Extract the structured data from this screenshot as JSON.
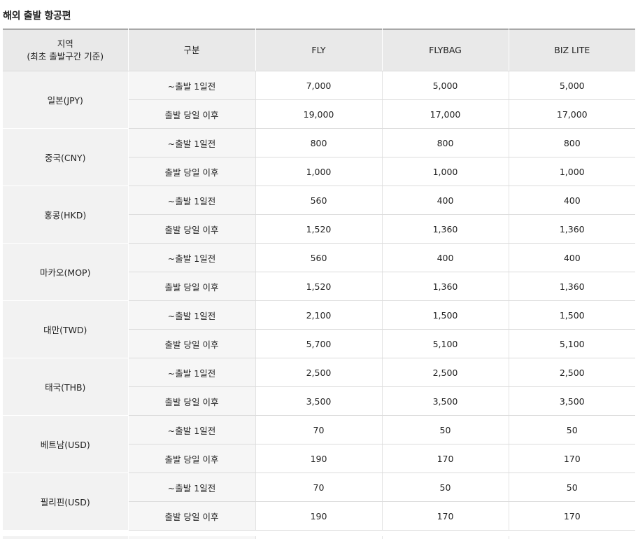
{
  "section_title": "해외 출발 항공편",
  "table": {
    "headers": {
      "region_line1": "지역",
      "region_line2": "(최초 출발구간 기준)",
      "type": "구분",
      "fare_columns": [
        "FLY",
        "FLYBAG",
        "BIZ LITE"
      ]
    },
    "regions": [
      {
        "name": "일본(JPY)",
        "rows": [
          {
            "type": "~출발 1일전",
            "fares": [
              "7,000",
              "5,000",
              "5,000"
            ]
          },
          {
            "type": "출발 당일 이후",
            "fares": [
              "19,000",
              "17,000",
              "17,000"
            ]
          }
        ]
      },
      {
        "name": "중국(CNY)",
        "rows": [
          {
            "type": "~출발 1일전",
            "fares": [
              "800",
              "800",
              "800"
            ]
          },
          {
            "type": "출발 당일 이후",
            "fares": [
              "1,000",
              "1,000",
              "1,000"
            ]
          }
        ]
      },
      {
        "name": "홍콩(HKD)",
        "rows": [
          {
            "type": "~출발 1일전",
            "fares": [
              "560",
              "400",
              "400"
            ]
          },
          {
            "type": "출발 당일 이후",
            "fares": [
              "1,520",
              "1,360",
              "1,360"
            ]
          }
        ]
      },
      {
        "name": "마카오(MOP)",
        "rows": [
          {
            "type": "~출발 1일전",
            "fares": [
              "560",
              "400",
              "400"
            ]
          },
          {
            "type": "출발 당일 이후",
            "fares": [
              "1,520",
              "1,360",
              "1,360"
            ]
          }
        ]
      },
      {
        "name": "대만(TWD)",
        "rows": [
          {
            "type": "~출발 1일전",
            "fares": [
              "2,100",
              "1,500",
              "1,500"
            ]
          },
          {
            "type": "출발 당일 이후",
            "fares": [
              "5,700",
              "5,100",
              "5,100"
            ]
          }
        ]
      },
      {
        "name": "태국(THB)",
        "rows": [
          {
            "type": "~출발 1일전",
            "fares": [
              "2,500",
              "2,500",
              "2,500"
            ]
          },
          {
            "type": "출발 당일 이후",
            "fares": [
              "3,500",
              "3,500",
              "3,500"
            ]
          }
        ]
      },
      {
        "name": "베트남(USD)",
        "rows": [
          {
            "type": "~출발 1일전",
            "fares": [
              "70",
              "50",
              "50"
            ]
          },
          {
            "type": "출발 당일 이후",
            "fares": [
              "190",
              "170",
              "170"
            ]
          }
        ]
      },
      {
        "name": "필리핀(USD)",
        "rows": [
          {
            "type": "~출발 1일전",
            "fares": [
              "70",
              "50",
              "50"
            ]
          },
          {
            "type": "출발 당일 이후",
            "fares": [
              "190",
              "170",
              "170"
            ]
          }
        ]
      }
    ]
  },
  "colors": {
    "header_bg": "#e9e9e9",
    "region_bg": "#f2f2f2",
    "type_bg": "#f6f6f6",
    "top_rule": "#333333",
    "row_rule": "#dcdcdc"
  }
}
